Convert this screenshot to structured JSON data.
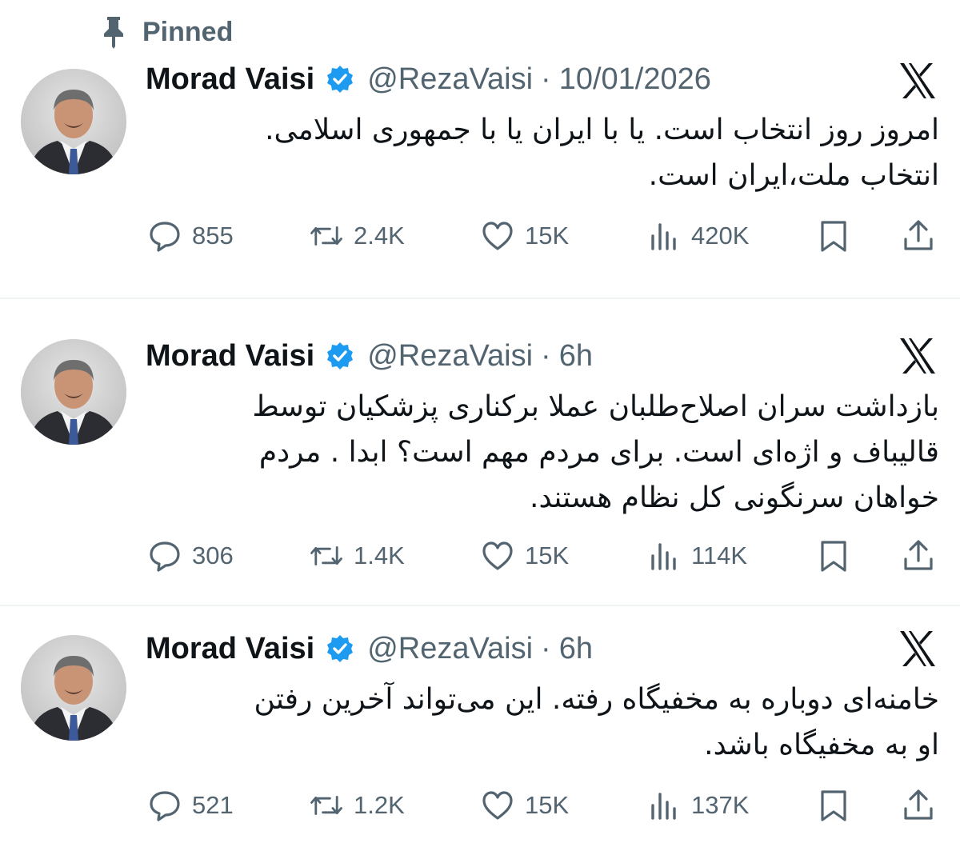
{
  "pinned": {
    "label": "Pinned",
    "icon": "pin-icon"
  },
  "colors": {
    "text": "#0f1419",
    "secondary": "#536471",
    "verified": "#1d9bf0",
    "divider": "#eff3f4"
  },
  "tweets": [
    {
      "author": {
        "name": "Morad Vaisi",
        "handle": "@RezaVaisi",
        "verified": true
      },
      "separator": "·",
      "time": "10/01/2026",
      "lines": [
        "امروز روز انتخاب است. یا  با ایران یا با جمهوری  اسلامی.",
        "انتخاب ملت،ایران  است."
      ],
      "stats": {
        "replies": "855",
        "reposts": "2.4K",
        "likes": "15K",
        "views": "420K"
      }
    },
    {
      "author": {
        "name": "Morad Vaisi",
        "handle": "@RezaVaisi",
        "verified": true
      },
      "separator": "·",
      "time": "6h",
      "lines": [
        "بازداشت سران اصلاح‌طلبان  عملا برکناری پزشکیان توسط",
        "قالیباف و اژه‌ای است. برای مردم مهم است؟ ابدا . مردم",
        "خواهان سرنگونی کل نظام هستند."
      ],
      "stats": {
        "replies": "306",
        "reposts": "1.4K",
        "likes": "15K",
        "views": "114K"
      }
    },
    {
      "author": {
        "name": "Morad Vaisi",
        "handle": "@RezaVaisi",
        "verified": true
      },
      "separator": "·",
      "time": "6h",
      "lines": [
        "خامنه‌ای دوباره به مخفیگاه رفته. این می‌تواند آخرین رفتن",
        "او به مخفیگاه باشد."
      ],
      "stats": {
        "replies": "521",
        "reposts": "1.2K",
        "likes": "15K",
        "views": "137K"
      }
    }
  ],
  "icons": {
    "reply": "reply-icon",
    "repost": "repost-icon",
    "like": "heart-icon",
    "views": "views-icon",
    "bookmark": "bookmark-icon",
    "share": "share-icon",
    "brand": "x-logo-icon",
    "badge": "verified-badge-icon"
  }
}
